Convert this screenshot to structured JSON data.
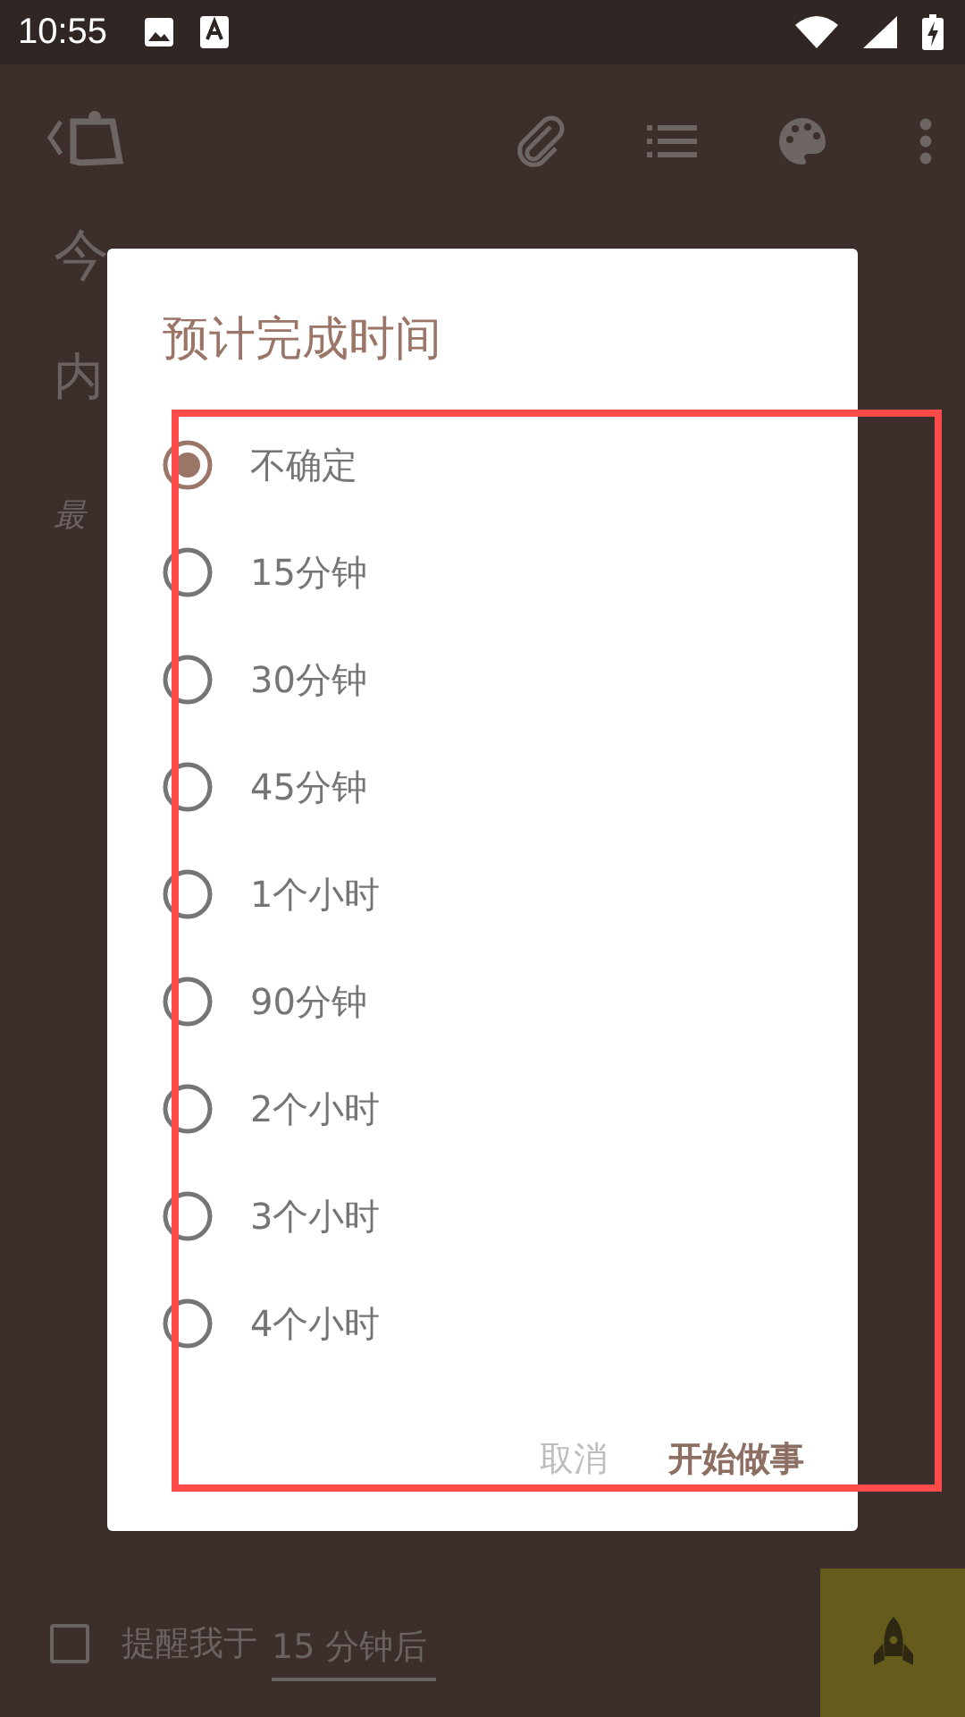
{
  "status_bar": {
    "time": "10:55"
  },
  "note": {
    "title": "今",
    "content": "内",
    "meta": "最"
  },
  "dialog": {
    "title": "预计完成时间",
    "options": [
      {
        "label": "不确定",
        "selected": true
      },
      {
        "label": "15分钟",
        "selected": false
      },
      {
        "label": "30分钟",
        "selected": false
      },
      {
        "label": "45分钟",
        "selected": false
      },
      {
        "label": "1个小时",
        "selected": false
      },
      {
        "label": "90分钟",
        "selected": false
      },
      {
        "label": "2个小时",
        "selected": false
      },
      {
        "label": "3个小时",
        "selected": false
      },
      {
        "label": "4个小时",
        "selected": false
      }
    ],
    "buttons": [
      {
        "label": "取消",
        "kind": "cancel"
      },
      {
        "label": "开始做事",
        "kind": "confirm"
      }
    ]
  },
  "reminder": {
    "checked": false,
    "label": "提醒我于",
    "value": "15 分钟后"
  }
}
